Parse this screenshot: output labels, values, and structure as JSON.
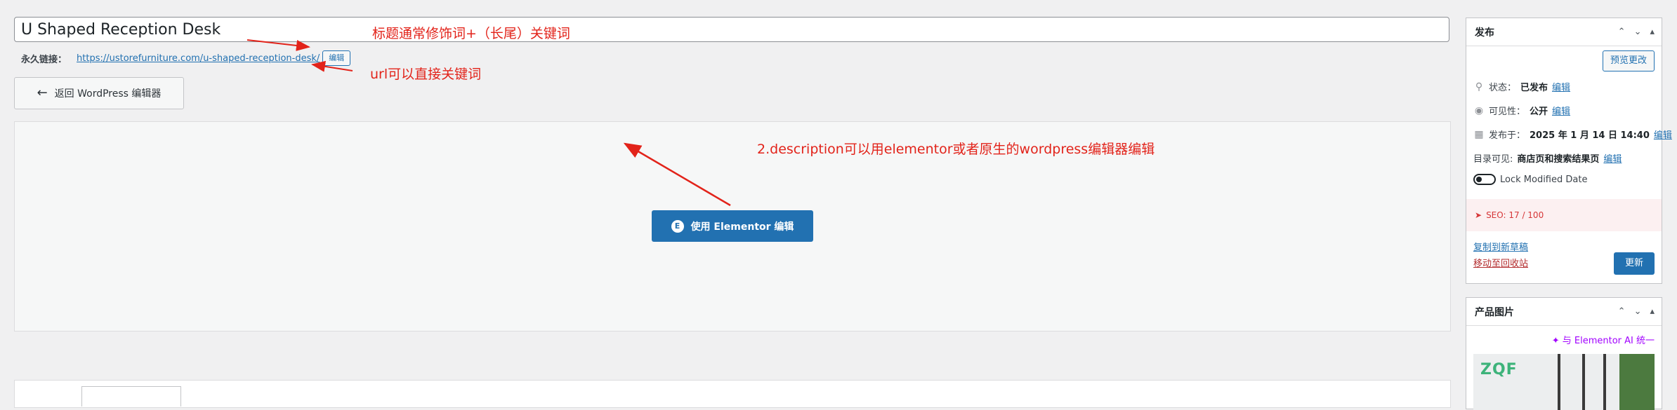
{
  "title": "U Shaped Reception Desk",
  "permalink": {
    "label": "永久链接：",
    "url": "https://ustorefurniture.com/u-shaped-reception-desk/",
    "edit_label": "编辑"
  },
  "back_button": "返回 WordPress 编辑器",
  "elementor_button": "使用 Elementor 编辑",
  "elementor_logo_letter": "E",
  "annotations": {
    "title_note": "标题通常修饰词+（长尾）关键词",
    "url_note": "url可以直接关键词",
    "desc_note": "2.description可以用elementor或者原生的wordpress编辑器编辑"
  },
  "publish": {
    "title": "发布",
    "preview_button": "预览更改",
    "status_label": "状态：",
    "status_value": "已发布",
    "visibility_label": "可见性：",
    "visibility_value": "公开",
    "published_label": "发布于：",
    "published_value": "2025 年 1 月 14 日 14:40",
    "catalog_label": "目录可见:",
    "catalog_value": "商店页和搜索结果页",
    "edit_label": "编辑",
    "lock_label": "Lock Modified Date",
    "lock_on": false,
    "seo": "SEO: 17 / 100",
    "copy_draft": "复制到新草稿",
    "move_trash": "移动至回收站",
    "update_button": "更新"
  },
  "product_image": {
    "title": "产品图片",
    "ai_link": "与 Elementor AI 统一",
    "logo_text": "ZQF"
  },
  "colors": {
    "annotation": "#e2231a",
    "primary": "#2271b1",
    "ai": "#a100ff",
    "seo": "#d63638"
  },
  "icons": {
    "back": "arrow-left-icon",
    "status": "pin-icon",
    "visibility": "eye-icon",
    "calendar": "calendar-icon",
    "seo": "seo-icon",
    "ai": "sparkle-icon"
  }
}
